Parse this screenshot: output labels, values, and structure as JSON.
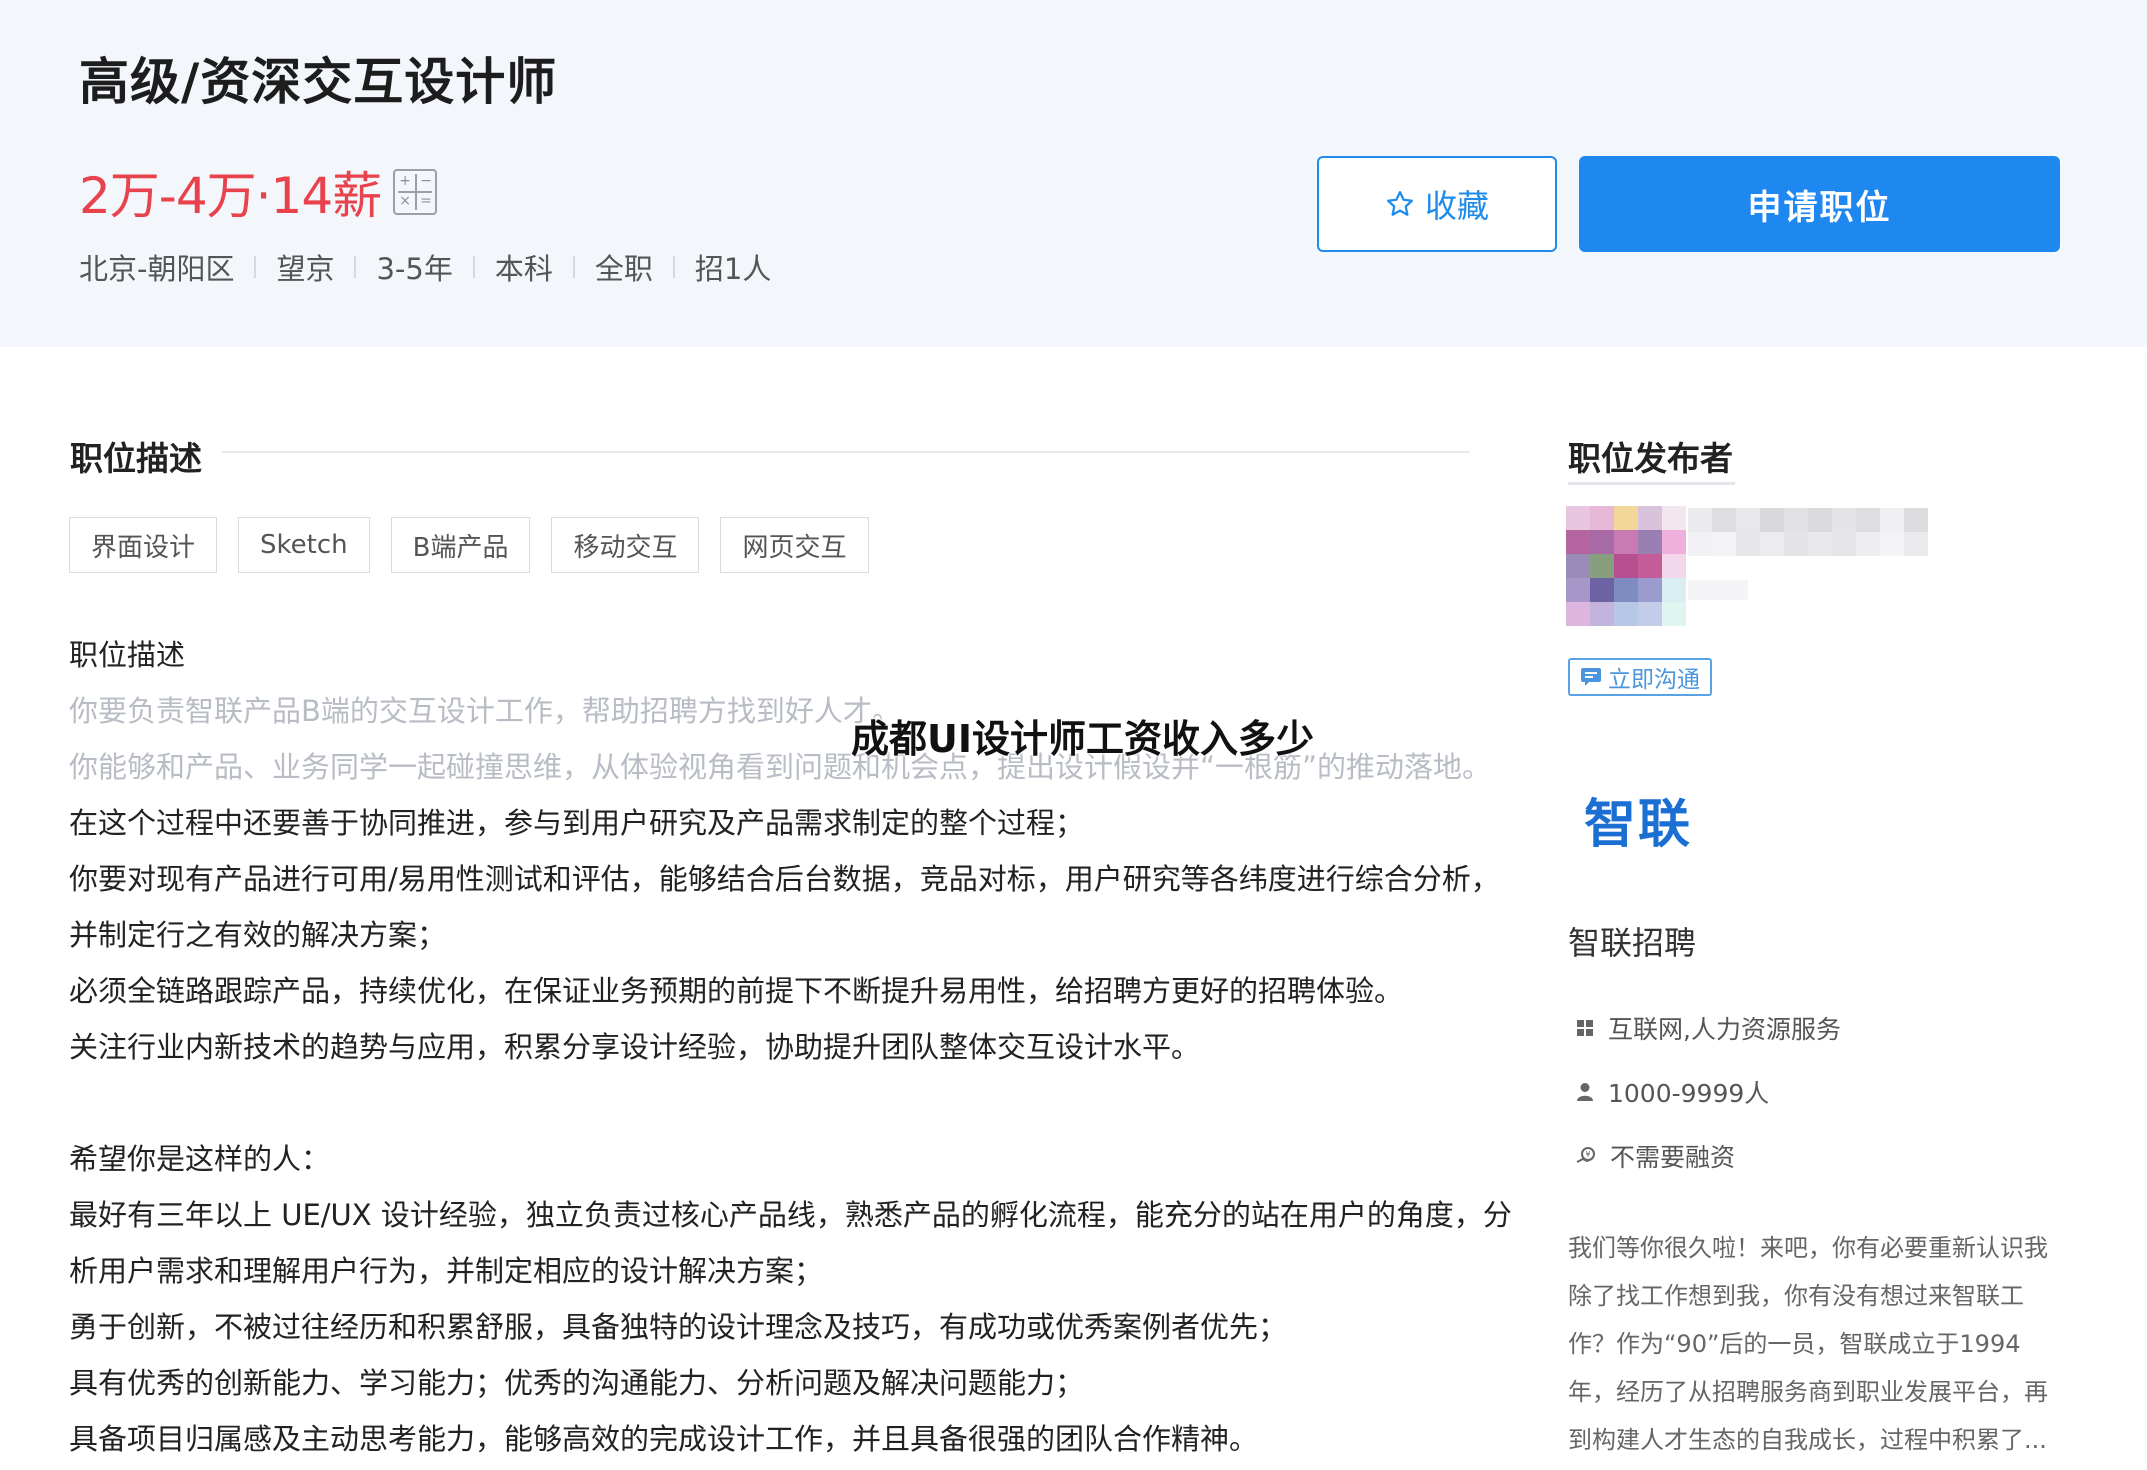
{
  "header": {
    "title": "高级/资深交互设计师",
    "salary": "2万-4万·14薪",
    "meta": [
      "北京-朝阳区",
      "望京",
      "3-5年",
      "本科",
      "全职",
      "招1人"
    ],
    "favorite_label": "收藏",
    "apply_label": "申请职位"
  },
  "description": {
    "section_title": "职位描述",
    "tags": [
      "界面设计",
      "Sketch",
      "B端产品",
      "移动交互",
      "网页交互"
    ],
    "heading": "职位描述",
    "lines_faded": [
      "你要负责智联产品B端的交互设计工作，帮助招聘方找到好人才。",
      "你能够和产品、业务同学一起碰撞思维，从体验视角看到问题和机会点，提出设计假设并“一根筋”的推动落地。"
    ],
    "lines_main": [
      "在这个过程中还要善于协同推进，参与到用户研究及产品需求制定的整个过程；",
      "你要对现有产品进行可用/易用性测试和评估，能够结合后台数据，竞品对标，用户研究等各纬度进行综合分析，",
      "并制定行之有效的解决方案；",
      "必须全链路跟踪产品，持续优化，在保证业务预期的前提下不断提升易用性，给招聘方更好的招聘体验。",
      "关注行业内新技术的趋势与应用，积累分享设计经验，协助提升团队整体交互设计水平。"
    ],
    "wish_heading": "希望你是这样的人：",
    "wish_lines": [
      "最好有三年以上 UE/UX 设计经验，独立负责过核心产品线，熟悉产品的孵化流程，能充分的站在用户的角度，分",
      "析用户需求和理解用户行为，并制定相应的设计解决方案；",
      "勇于创新，不被过往经历和积累舒服，具备独特的设计理念及技巧，有成功或优秀案例者优先；",
      "具有优秀的创新能力、学习能力；优秀的沟通能力、分析问题及解决问题能力；",
      "具备项目归属感及主动思考能力，能够高效的完成设计工作，并且具备很强的团队合作精神。"
    ]
  },
  "watermark": "成都UI设计师工资收入多少",
  "sidebar": {
    "title": "职位发布者",
    "chat_label": "立即沟通",
    "logo_text": "智联",
    "company_name": "智联招聘",
    "industry": "互联网,人力资源服务",
    "size": "1000-9999人",
    "financing": "不需要融资",
    "about": [
      "我们等你很久啦！来吧，你有必要重新认识我",
      "除了找工作想到我，你有没有想过来智联工",
      "作？作为“90”后的一员，智联成立于1994",
      "年，经历了从招聘服务商到职业发展平台，再",
      "到构建人才生态的自我成长，过程中积累了..."
    ]
  },
  "colors": {
    "accent": "#1e88f0",
    "salary": "#e8424d",
    "header_bg": "#f3f7fc"
  }
}
